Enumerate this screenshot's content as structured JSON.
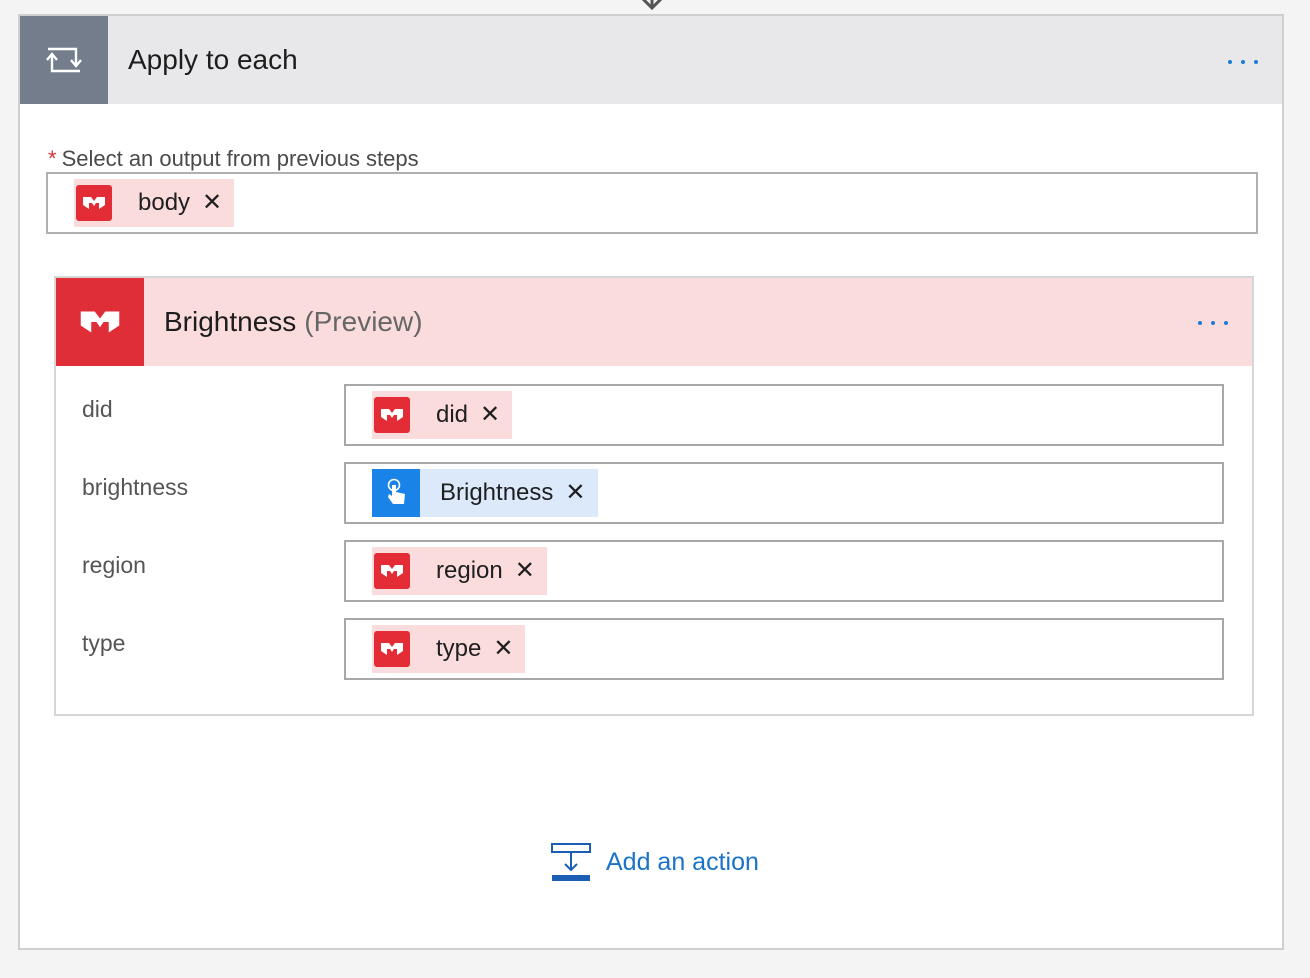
{
  "loop": {
    "title": "Apply to each",
    "icon": "loop-icon",
    "menu_icon": "ellipsis-icon",
    "output_required_mark": "*",
    "output_label": "Select an output from previous steps",
    "output_token": {
      "label": "body",
      "icon": "connector-logo-icon",
      "color": "#e32c35"
    }
  },
  "action": {
    "title": "Brightness",
    "badge": "(Preview)",
    "icon": "connector-logo-icon",
    "menu_icon": "ellipsis-icon",
    "params": [
      {
        "label": "did",
        "token": "did",
        "token_type": "red"
      },
      {
        "label": "brightness",
        "token": "Brightness",
        "token_type": "blue"
      },
      {
        "label": "region",
        "token": "region",
        "token_type": "red"
      },
      {
        "label": "type",
        "token": "type",
        "token_type": "red"
      }
    ]
  },
  "footer": {
    "add_action_label": "Add an action",
    "add_action_icon": "add-step-icon"
  },
  "colors": {
    "loop_icon_bg": "#737d8b",
    "brand_red": "#e02e38",
    "token_red_bg": "#fbdcdd",
    "token_blue_bg": "#dbe9fb",
    "trigger_blue": "#1a83e8",
    "link_blue": "#1a73c8"
  }
}
